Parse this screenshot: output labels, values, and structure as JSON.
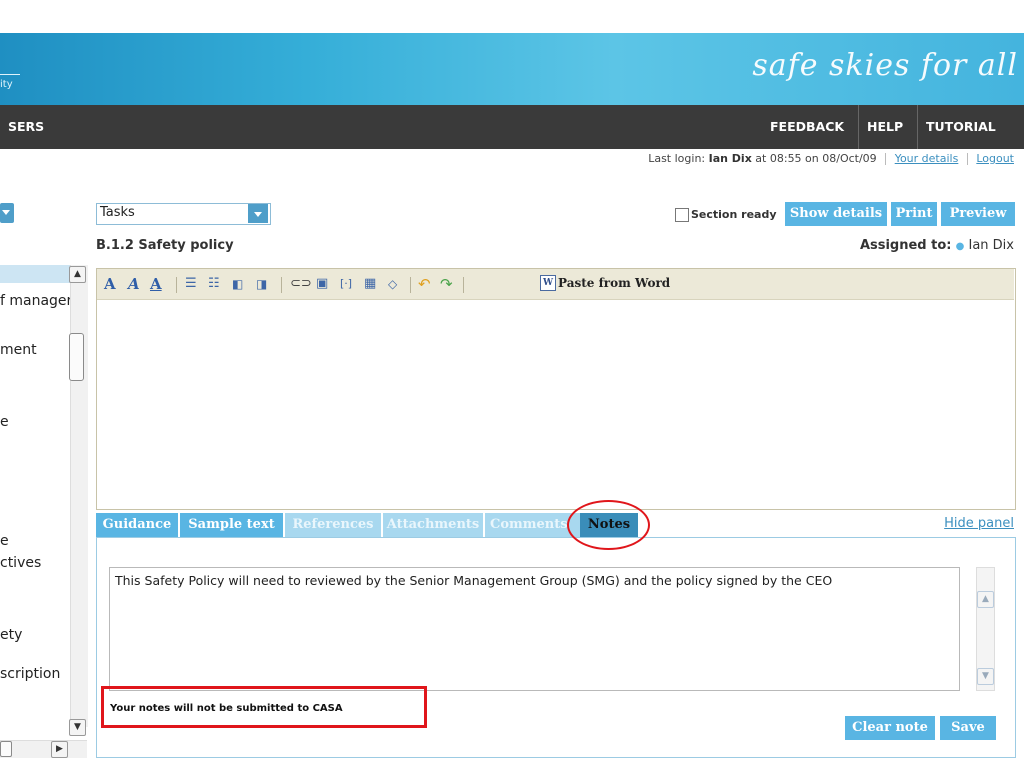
{
  "header": {
    "brand_fragment": "ity",
    "tagline": "safe skies for all"
  },
  "nav": {
    "left_item": "SERS",
    "feedback": "FEEDBACK",
    "help": "HELP",
    "tutorial": "TUTORIAL"
  },
  "login": {
    "prefix": "Last login: ",
    "user": "Ian Dix",
    "when": " at 08:55 on 08/Oct/09",
    "your_details": "Your details",
    "logout": "Logout"
  },
  "sidebar": {
    "items": [
      "f manager",
      "ment",
      "e",
      "e",
      "ctives",
      "ety",
      "scription"
    ]
  },
  "tasks": {
    "selected": "Tasks"
  },
  "actions": {
    "section_ready": "Section ready",
    "show_details": "Show details",
    "print": "Print",
    "preview": "Preview"
  },
  "section": {
    "title": "B.1.2  Safety policy",
    "assigned_label": "Assigned to:",
    "assigned_name": "Ian Dix"
  },
  "editor": {
    "paste_from_word": "Paste from Word",
    "paste_icon_letter": "W",
    "toolbar_icons": [
      "font-icon",
      "italic-font-icon",
      "underline-font-icon",
      "numbered-list-icon",
      "bullet-list-icon",
      "outdent-icon",
      "indent-icon",
      "link-icon",
      "image-icon",
      "special-char-icon",
      "table-icon",
      "source-icon",
      "undo-icon",
      "redo-icon",
      "paste-word-icon"
    ]
  },
  "tabs": {
    "guidance": "Guidance",
    "sample_text": "Sample text",
    "references": "References",
    "attachments": "Attachments",
    "comments": "Comments",
    "notes": "Notes",
    "hide_panel": "Hide panel"
  },
  "notes": {
    "content": "This Safety Policy will need to reviewed by the Senior Management Group (SMG) and the policy signed by the CEO",
    "warning": "Your notes will not be submitted to CASA",
    "clear_note": "Clear note",
    "save": "Save"
  },
  "colors": {
    "accent": "#59b5e3",
    "nav_bg": "#3a3a3a",
    "annotation": "#e0161b"
  }
}
